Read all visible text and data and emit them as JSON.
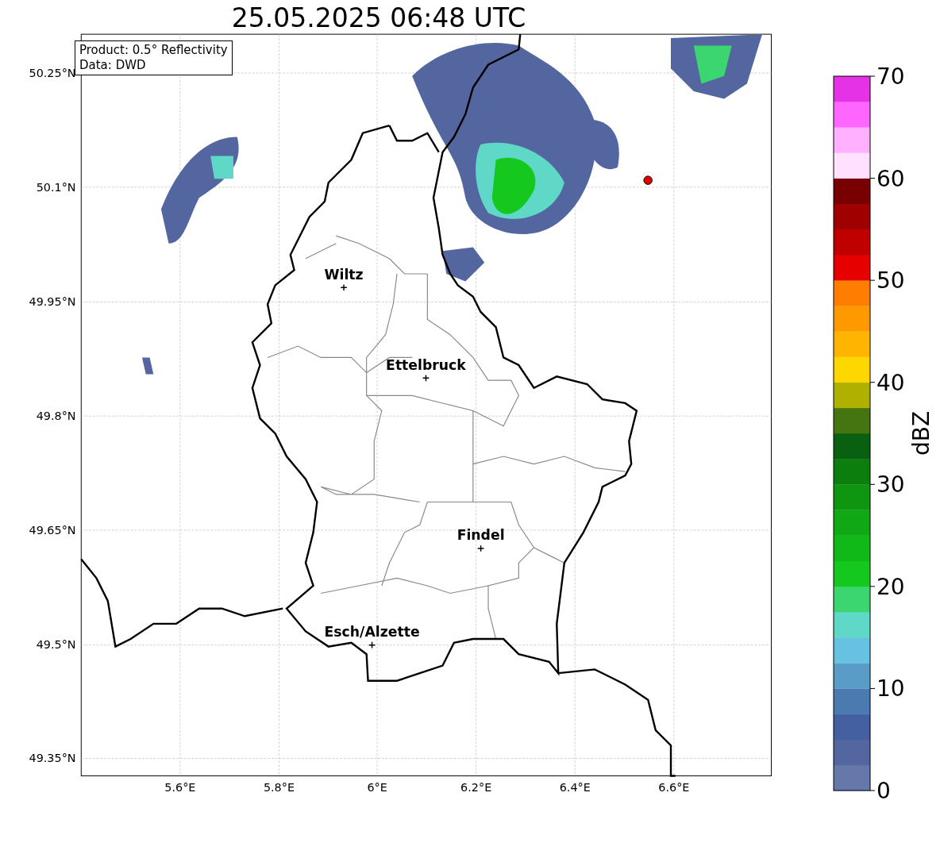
{
  "title": "25.05.2025 06:48 UTC",
  "info_box": [
    "Product: 0.5° Reflectivity",
    "Data: DWD"
  ],
  "x_ticks": [
    "5.6°E",
    "5.8°E",
    "6°E",
    "6.2°E",
    "6.4°E",
    "6.6°E"
  ],
  "y_ticks": [
    "50.25°N",
    "50.1°N",
    "49.95°N",
    "49.8°N",
    "49.65°N",
    "49.5°N",
    "49.35°N"
  ],
  "cities": [
    {
      "name": "Wiltz"
    },
    {
      "name": "Ettelbruck"
    },
    {
      "name": "Findel"
    },
    {
      "name": "Esch/Alzette"
    }
  ],
  "site_marker": {
    "color": "#e00000"
  },
  "colorbar": {
    "label": "dBZ",
    "ticks": [
      "70",
      "60",
      "50",
      "40",
      "30",
      "20",
      "10",
      "0"
    ],
    "bins": [
      {
        "color": "#6677aa"
      },
      {
        "color": "#5466a0"
      },
      {
        "color": "#4460a0"
      },
      {
        "color": "#4a7ab0"
      },
      {
        "color": "#5a9cc8"
      },
      {
        "color": "#66c2e0"
      },
      {
        "color": "#60d8c8"
      },
      {
        "color": "#3cd670"
      },
      {
        "color": "#14c81e"
      },
      {
        "color": "#10b818"
      },
      {
        "color": "#10a814"
      },
      {
        "color": "#0e9610"
      },
      {
        "color": "#0c7e0e"
      },
      {
        "color": "#086010"
      },
      {
        "color": "#447510"
      },
      {
        "color": "#b0b000"
      },
      {
        "color": "#ffd700"
      },
      {
        "color": "#ffb400"
      },
      {
        "color": "#ff9900"
      },
      {
        "color": "#ff7d00"
      },
      {
        "color": "#e60000"
      },
      {
        "color": "#c00000"
      },
      {
        "color": "#a00000"
      },
      {
        "color": "#780000"
      },
      {
        "color": "#ffe0ff"
      },
      {
        "color": "#ffb0ff"
      },
      {
        "color": "#ff66ff"
      },
      {
        "color": "#e632e6"
      }
    ]
  }
}
